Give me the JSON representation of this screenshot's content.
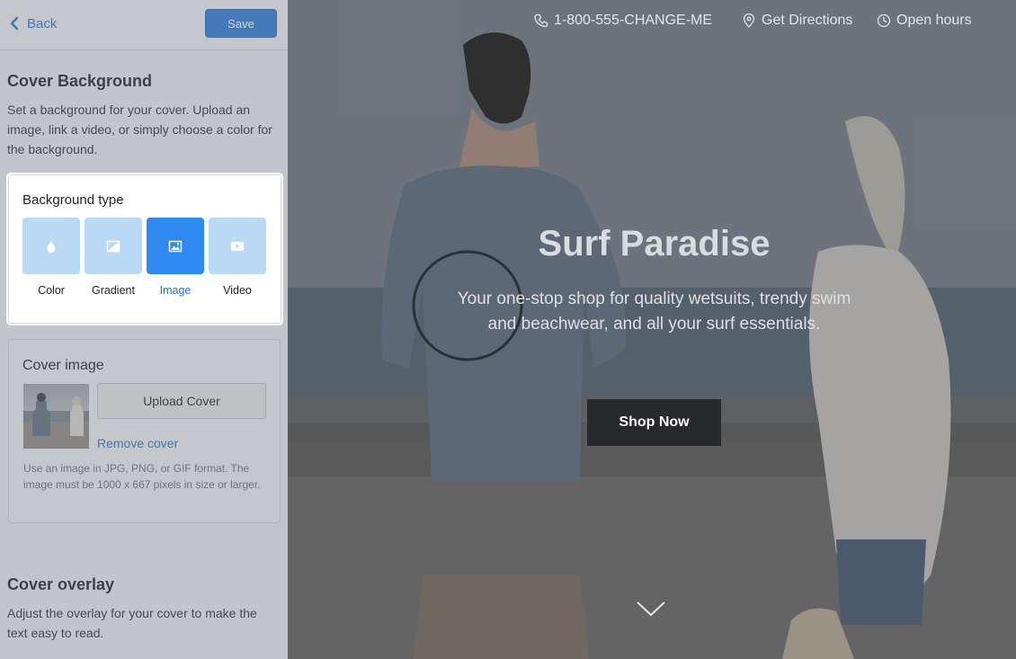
{
  "editor": {
    "back_label": "Back",
    "save_label": "Save",
    "cover_background": {
      "title": "Cover Background",
      "description": "Set a background for your cover. Upload an image, link a video, or simply choose a color for the background."
    },
    "background_type": {
      "title": "Background type",
      "options": [
        {
          "label": "Color",
          "icon": "droplet-icon",
          "selected": false
        },
        {
          "label": "Gradient",
          "icon": "gradient-icon",
          "selected": false
        },
        {
          "label": "Image",
          "icon": "image-icon",
          "selected": true
        },
        {
          "label": "Video",
          "icon": "video-icon",
          "selected": false
        }
      ]
    },
    "cover_image": {
      "title": "Cover image",
      "upload_label": "Upload Cover",
      "remove_label": "Remove cover",
      "hint": "Use an image in JPG, PNG, or GIF format. The image must be 1000 x 667 pixels in size or larger."
    },
    "cover_overlay": {
      "title": "Cover overlay",
      "description": "Adjust the overlay for your cover to make the text easy to read."
    }
  },
  "preview": {
    "phone": "1-800-555-CHANGE-ME",
    "directions": "Get Directions",
    "hours": "Open hours",
    "title": "Surf Paradise",
    "subtitle": "Your one-stop shop for quality wetsuits, trendy swim and beachwear, and all your surf essentials.",
    "cta": "Shop Now"
  },
  "colors": {
    "accent": "#2a7ad8",
    "selected_tile": "#2f8af0",
    "unselected_tile": "#b9d9f7",
    "cta_bg": "#27292c"
  }
}
